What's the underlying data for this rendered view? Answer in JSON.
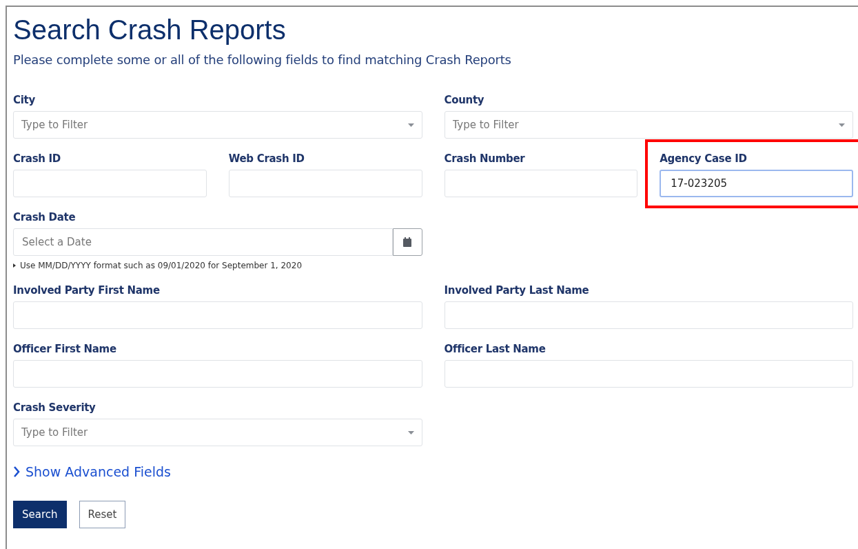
{
  "page": {
    "title": "Search Crash Reports",
    "subtitle": "Please complete some or all of the following fields to find matching Crash Reports"
  },
  "form_rows": [
    [
      {
        "kind": "select",
        "label": "City",
        "placeholder": "Type to Filter",
        "highlighted": false
      },
      {
        "kind": "select",
        "label": "County",
        "placeholder": "Type to Filter",
        "highlighted": false
      }
    ],
    [
      {
        "kind": "text",
        "label": "Crash ID",
        "highlighted": false
      },
      {
        "kind": "text",
        "label": "Web Crash ID",
        "highlighted": false
      },
      {
        "kind": "text",
        "label": "Crash Number",
        "highlighted": false
      },
      {
        "kind": "text",
        "label": "Agency Case ID",
        "value": "17-023205",
        "highlighted": true
      }
    ],
    [
      {
        "kind": "date",
        "label": "Crash Date",
        "placeholder": "Select a Date",
        "hint": "Use MM/DD/YYYY format such as 09/01/2020 for September 1, 2020",
        "highlighted": false
      }
    ],
    [
      {
        "kind": "text",
        "label": "Involved Party First Name",
        "highlighted": false
      },
      {
        "kind": "text",
        "label": "Involved Party Last Name",
        "highlighted": false
      }
    ],
    [
      {
        "kind": "text",
        "label": "Officer First Name",
        "highlighted": false
      },
      {
        "kind": "text",
        "label": "Officer Last Name",
        "highlighted": false
      }
    ],
    [
      {
        "kind": "select",
        "label": "Crash Severity",
        "placeholder": "Type to Filter",
        "highlighted": false
      }
    ]
  ],
  "advanced_link": "Show Advanced Fields",
  "buttons": [
    {
      "kind": "primary",
      "label": "Search"
    },
    {
      "kind": "secondary",
      "label": "Reset"
    }
  ]
}
